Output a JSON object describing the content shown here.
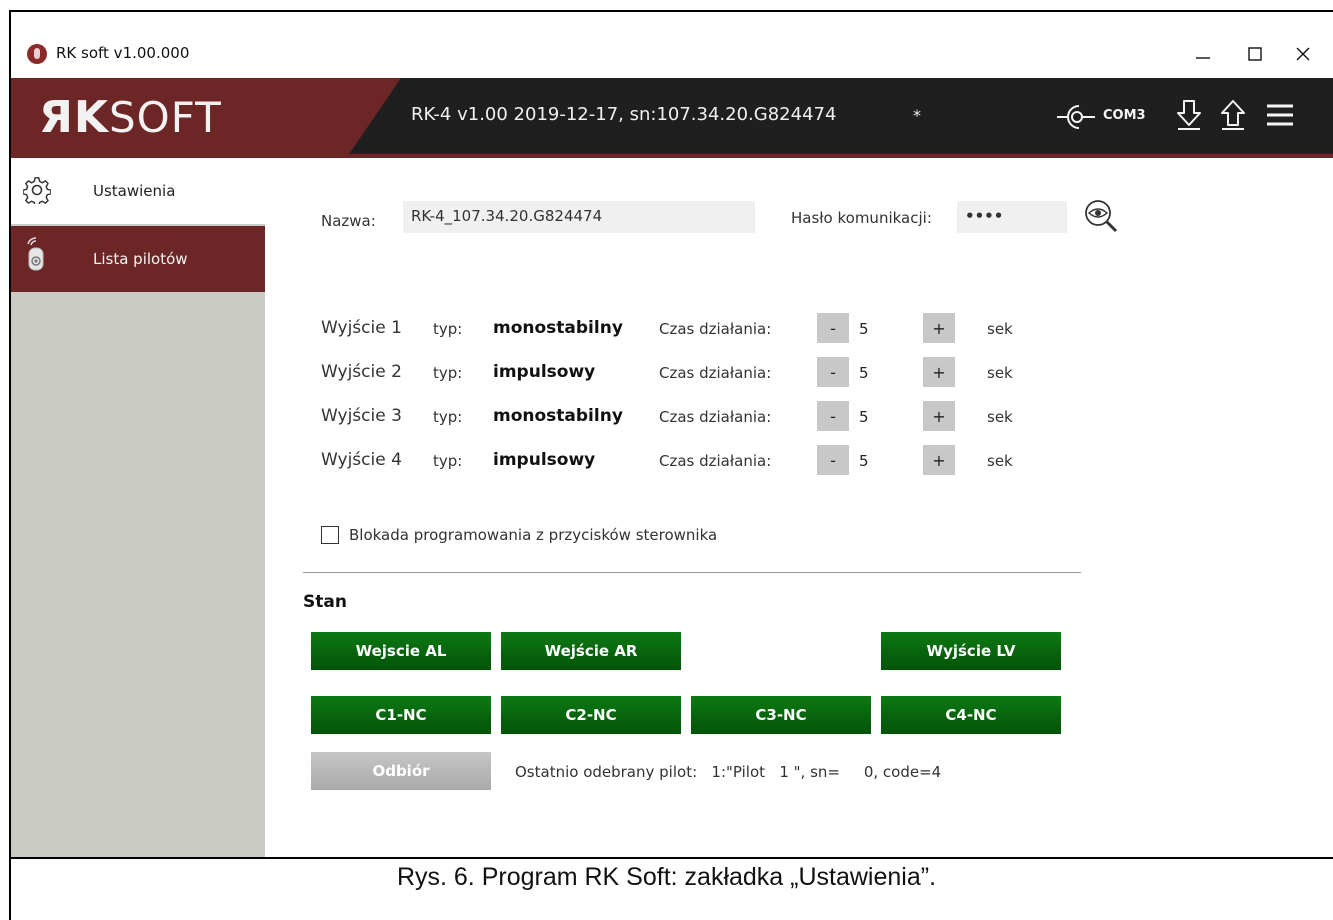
{
  "window": {
    "title": "RK soft v1.00.000",
    "minimize_icon": "minimize-icon",
    "maximize_icon": "maximize-icon",
    "close_icon": "close-icon"
  },
  "header": {
    "logo_mark": "ЯK",
    "logo_text": "SOFT",
    "device_info": "RK-4 v1.00 2019-12-17, sn:107.34.20.G824474",
    "modified_marker": "*",
    "port_label": "COM3",
    "icons": [
      "connect-icon",
      "download-icon",
      "upload-icon",
      "menu-icon"
    ],
    "colors": {
      "accent": "#6d2626",
      "bar": "#1f1f1f"
    }
  },
  "sidebar": {
    "items": [
      {
        "label": "Ustawienia",
        "icon": "gear-icon",
        "active": true
      },
      {
        "label": "Lista pilotów",
        "icon": "remote-icon",
        "active": false
      }
    ]
  },
  "settings": {
    "name_label": "Nazwa:",
    "name_value": "RK-4_107.34.20.G824474",
    "password_label": "Hasło komunikacji:",
    "password_value": "••••",
    "outputs": [
      {
        "name": "Wyjście 1",
        "typ_label": "typ:",
        "type": "monostabilny",
        "time_label": "Czas działania:",
        "minus": "-",
        "value": "5",
        "plus": "+",
        "unit": "sek"
      },
      {
        "name": "Wyjście 2",
        "typ_label": "typ:",
        "type": "impulsowy",
        "time_label": "Czas działania:",
        "minus": "-",
        "value": "5",
        "plus": "+",
        "unit": "sek"
      },
      {
        "name": "Wyjście 3",
        "typ_label": "typ:",
        "type": "monostabilny",
        "time_label": "Czas działania:",
        "minus": "-",
        "value": "5",
        "plus": "+",
        "unit": "sek"
      },
      {
        "name": "Wyjście 4",
        "typ_label": "typ:",
        "type": "impulsowy",
        "time_label": "Czas działania:",
        "minus": "-",
        "value": "5",
        "plus": "+",
        "unit": "sek"
      }
    ],
    "block_label": "Blokada programowania z przycisków sterownika",
    "block_checked": false
  },
  "status": {
    "title": "Stan",
    "row1": [
      "Wejscie AL",
      "Wejście AR",
      "Wyjście LV"
    ],
    "row2": [
      "C1-NC",
      "C2-NC",
      "C3-NC",
      "C4-NC"
    ],
    "receive_button": "Odbiór",
    "last_pilot": "Ostatnio odebrany pilot:   1:\"Pilot   1 \", sn=     0, code=4"
  },
  "caption": "Rys. 6. Program RK Soft: zakładka „Ustawienia”."
}
